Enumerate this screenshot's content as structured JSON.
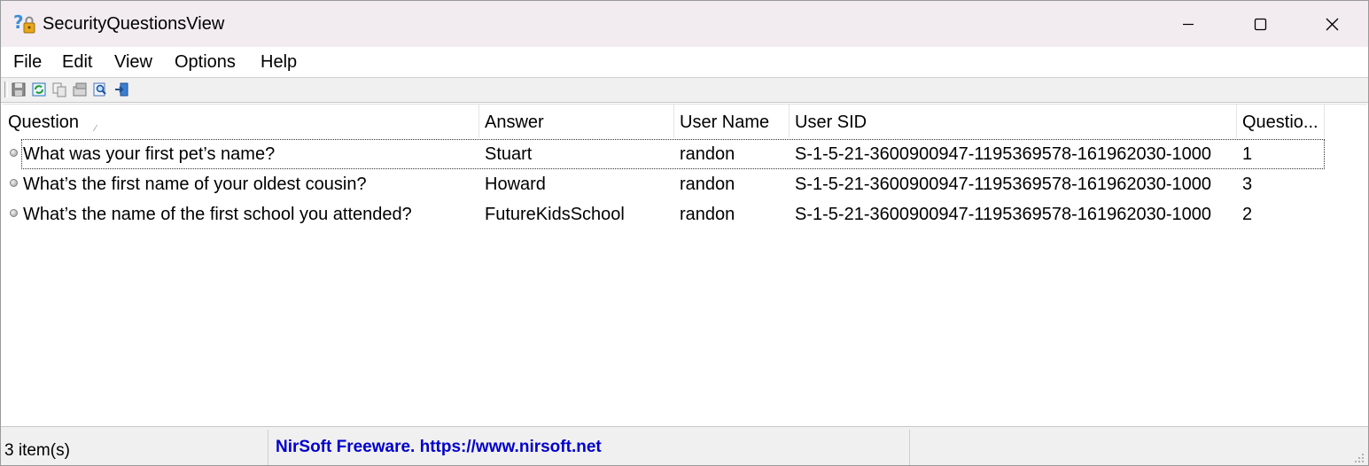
{
  "window": {
    "title": "SecurityQuestionsView"
  },
  "menu": [
    "File",
    "Edit",
    "View",
    "Options",
    "Help"
  ],
  "toolbar": {
    "buttons": [
      "save-icon",
      "refresh-icon",
      "copy-icon",
      "properties-icon",
      "find-icon",
      "exit-icon"
    ]
  },
  "table": {
    "columns": [
      "Question",
      "Answer",
      "User Name",
      "User SID",
      "Questio..."
    ],
    "sort_column": "Question",
    "rows": [
      {
        "question": "What was your first pet’s name?",
        "answer": "Stuart",
        "user": "randon",
        "sid": "S-1-5-21-3600900947-1195369578-161962030-1000",
        "qnum": "1"
      },
      {
        "question": "What’s the first name of your oldest cousin?",
        "answer": "Howard",
        "user": "randon",
        "sid": "S-1-5-21-3600900947-1195369578-161962030-1000",
        "qnum": "3"
      },
      {
        "question": "What’s the name of the first school you attended?",
        "answer": "FutureKidsSchool",
        "user": "randon",
        "sid": "S-1-5-21-3600900947-1195369578-161962030-1000",
        "qnum": "2"
      }
    ]
  },
  "status": {
    "count": "3 item(s)",
    "link": "NirSoft Freeware. https://www.nirsoft.net"
  },
  "colors": {
    "titlebar_bg": "#f2ecf1",
    "link_color": "#0000cc"
  }
}
